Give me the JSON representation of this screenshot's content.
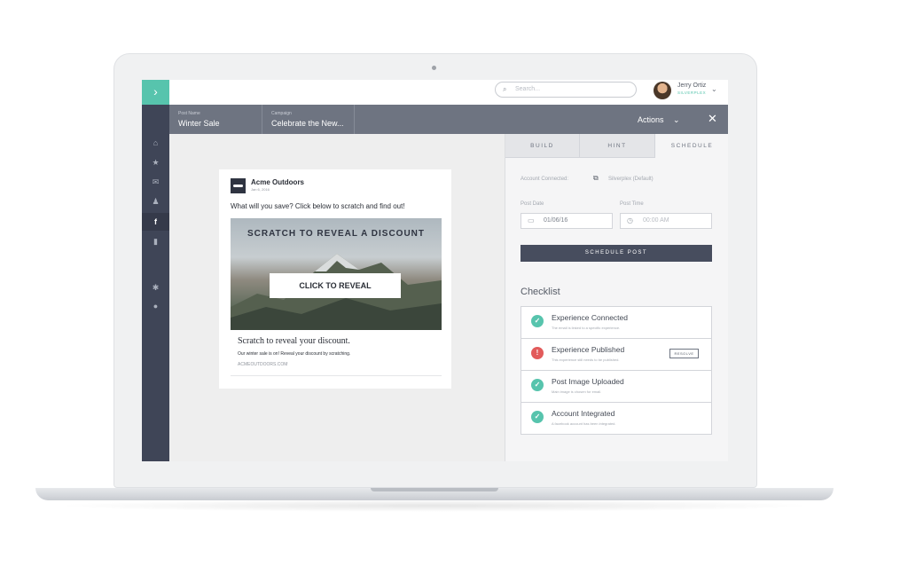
{
  "colors": {
    "accent": "#57c4ad",
    "sidebar": "#3f4557",
    "subbar": "#6e7481",
    "success": "#57c4ad",
    "error": "#e25b5b",
    "button": "#474d5e"
  },
  "brand": {
    "icon": "chevron-right-icon",
    "glyph": "›"
  },
  "sidebar": {
    "items": [
      {
        "name": "home-icon",
        "glyph": "⌂"
      },
      {
        "name": "star-icon",
        "glyph": "★"
      },
      {
        "name": "mail-icon",
        "glyph": "✉"
      },
      {
        "name": "user-group-icon",
        "glyph": "♟"
      },
      {
        "name": "facebook-icon",
        "glyph": "f",
        "active": true
      },
      {
        "name": "chart-icon",
        "glyph": "▮"
      },
      {
        "name": "gear-icon",
        "glyph": "✱"
      },
      {
        "name": "person-icon",
        "glyph": "●"
      }
    ]
  },
  "topbar": {
    "search_placeholder": "Search...",
    "user_name": "Jerry Ortiz",
    "user_org": "SILVERPLEX"
  },
  "subbar": {
    "post_name_label": "Post Name",
    "post_name": "Winter Sale",
    "campaign_label": "Campaign",
    "campaign": "Celebrate the New...",
    "actions": "Actions"
  },
  "post": {
    "brand": "Acme Outdoors",
    "date": "Jan 6, 2016",
    "text": "What will you save? Click below to scratch and find out!",
    "media_heading": "SCRATCH TO REVEAL A DISCOUNT",
    "reveal_button": "CLICK TO REVEAL",
    "headline": "Scratch to reveal your discount.",
    "description": "Our winter sale is on! Reveal your discount by scratching.",
    "link": "ACMEOUTDOORS.COM"
  },
  "panel": {
    "tabs": [
      "BUILD",
      "HINT",
      "SCHEDULE"
    ],
    "active_tab": "SCHEDULE",
    "account_label": "Account Connected:",
    "account_value": "Silverplex (Default)",
    "post_date_label": "Post Date",
    "post_date": "01/06/16",
    "post_time_label": "Post Time",
    "post_time": "00:00 AM",
    "schedule_button": "SCHEDULE POST",
    "checklist_title": "Checklist",
    "checklist": [
      {
        "title": "Experience Connected",
        "subtitle": "The email is linked to a specific experience.",
        "status": "ok"
      },
      {
        "title": "Experience Published",
        "subtitle": "This experience still needs to be published.",
        "status": "error",
        "action": "RESOLVE"
      },
      {
        "title": "Post Image Uploaded",
        "subtitle": "Main image is chosen for email.",
        "status": "ok"
      },
      {
        "title": "Account Integrated",
        "subtitle": "A facebook account has been integrated.",
        "status": "ok"
      }
    ]
  }
}
